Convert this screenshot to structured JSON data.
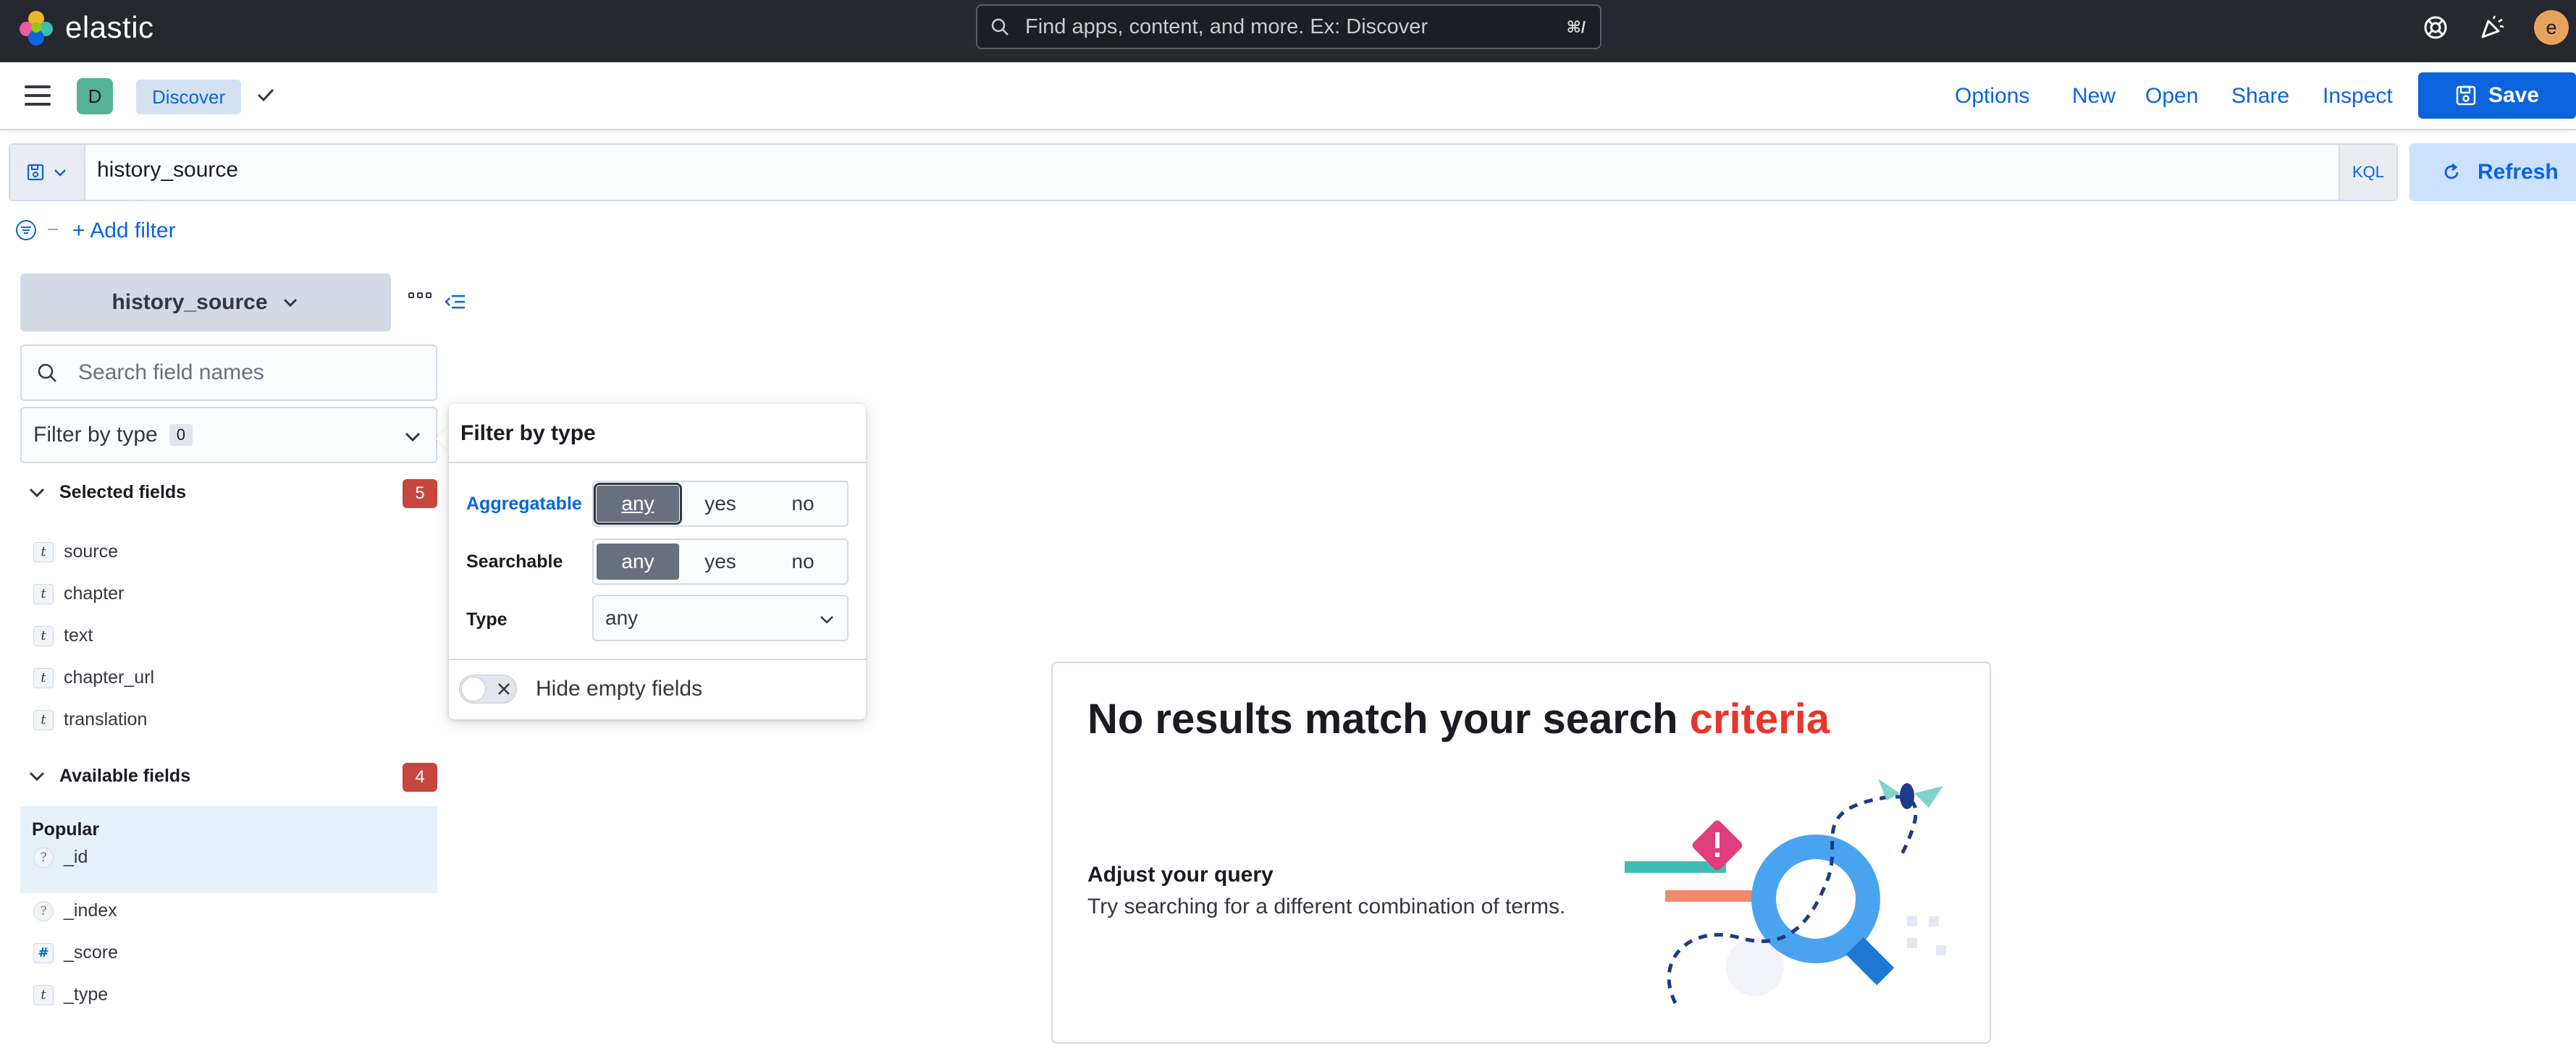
{
  "header": {
    "brand": "elastic",
    "search_placeholder": "Find apps, content, and more. Ex: Discover",
    "search_shortcut": "⌘/",
    "user_initial": "e"
  },
  "appbar": {
    "space_initial": "D",
    "breadcrumb": "Discover",
    "links": [
      "Options",
      "New",
      "Open",
      "Share",
      "Inspect"
    ],
    "save_label": "Save"
  },
  "querybar": {
    "query": "history_source",
    "language": "KQL",
    "refresh_label": "Refresh"
  },
  "filters": {
    "add_filter_label": "+ Add filter"
  },
  "sidebar": {
    "data_view": "history_source",
    "field_search_placeholder": "Search field names",
    "filter_by_type_label": "Filter by type",
    "filter_by_type_count": "0",
    "selected_fields": {
      "label": "Selected fields",
      "count": "5",
      "items": [
        {
          "type": "t",
          "name": "source"
        },
        {
          "type": "t",
          "name": "chapter"
        },
        {
          "type": "t",
          "name": "text"
        },
        {
          "type": "t",
          "name": "chapter_url"
        },
        {
          "type": "t",
          "name": "translation"
        }
      ]
    },
    "available_fields": {
      "label": "Available fields",
      "count": "4",
      "popular_label": "Popular",
      "popular_items": [
        {
          "type": "?",
          "name": "_id"
        }
      ],
      "items": [
        {
          "type": "?",
          "name": "_index"
        },
        {
          "type": "#",
          "name": "_score"
        },
        {
          "type": "t",
          "name": "_type"
        }
      ]
    }
  },
  "popover": {
    "title": "Filter by type",
    "aggregatable_label": "Aggregatable",
    "searchable_label": "Searchable",
    "type_label": "Type",
    "options": [
      "any",
      "yes",
      "no"
    ],
    "aggregatable_selected": "any",
    "searchable_selected": "any",
    "type_value": "any",
    "hide_empty_label": "Hide empty fields",
    "hide_empty_on": false
  },
  "empty_state": {
    "title_main": "No results match your search ",
    "title_accent": "criteria",
    "subtitle": "Adjust your query",
    "body": "Try searching for a different combination of terms."
  },
  "colors": {
    "header_bg": "#25282f",
    "primary": "#0b64dd",
    "badge_red": "#bd271e",
    "accent_red": "#e7362c",
    "space_badge": "#54b399"
  }
}
